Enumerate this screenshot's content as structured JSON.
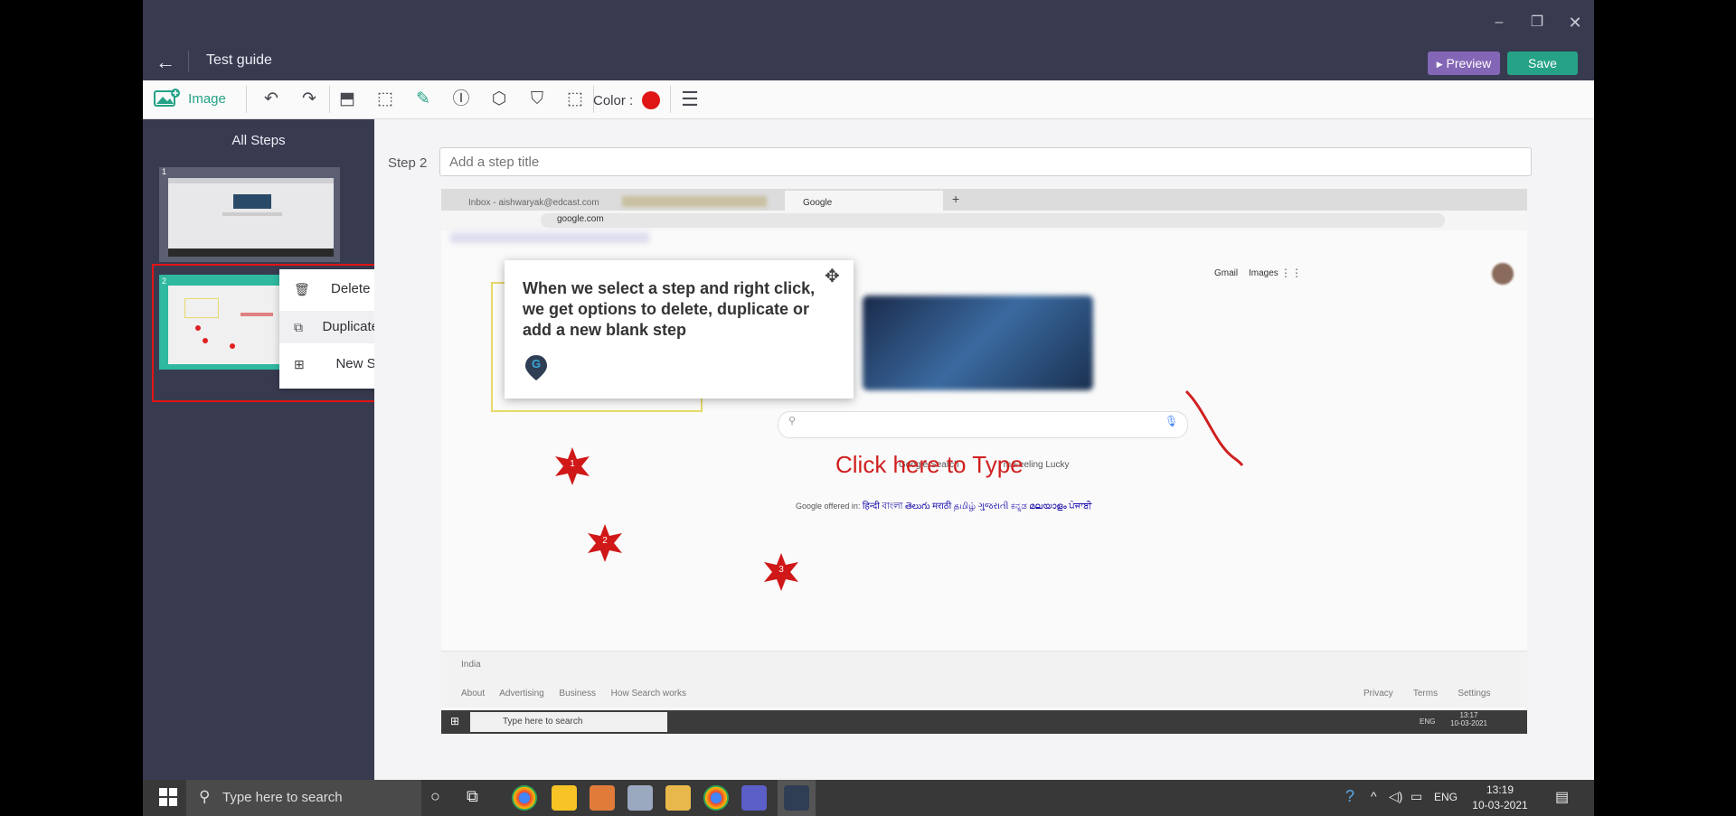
{
  "window": {
    "title": "Test guide",
    "controls": {
      "minimize": "–",
      "restore": "❐",
      "close": "✕"
    }
  },
  "header": {
    "back_icon": "←",
    "preview_label": "Preview",
    "save_label": "Save"
  },
  "toolbar": {
    "image_label": "Image",
    "color_label": "Color :",
    "current_color": "#e01515",
    "icons": {
      "undo": "↶",
      "redo": "↷",
      "shape": "⬒",
      "crop": "⬚",
      "pen": "✎",
      "text": "Ⓘ",
      "hexagon": "⬡",
      "stamp": "⛉",
      "select": "⬚",
      "menu": "☰"
    }
  },
  "sidebar": {
    "heading": "All Steps",
    "steps": [
      {
        "number": "1"
      },
      {
        "number": "2"
      }
    ],
    "context_menu": [
      {
        "label": "Delete step",
        "icon": "🗑"
      },
      {
        "label": "Duplicate step",
        "icon": "⧉"
      },
      {
        "label": "New Step",
        "icon": "⊞"
      }
    ]
  },
  "editor": {
    "step_label": "Step 2",
    "title_placeholder": "Add a step title"
  },
  "screenshot": {
    "tabs": [
      {
        "label": "Inbox - aishwaryak@edcast.com"
      },
      {
        "label": "Google"
      }
    ],
    "new_tab": "+",
    "url": "google.com",
    "header_links": {
      "gmail": "Gmail",
      "images": "Images"
    },
    "annotation_text": "Click here to Type",
    "stars": [
      "1",
      "2",
      "3"
    ],
    "search_buttons": {
      "search": "Google Search",
      "lucky": "I'm Feeling Lucky"
    },
    "offered_in": "Google offered in:",
    "languages": [
      "हिन्दी",
      "বাংলা",
      "తెలుగు",
      "मराठी",
      "தமிழ்",
      "ગુજરાતી",
      "ಕನ್ನಡ",
      "മലയാളം",
      "ਪੰਜਾਬੀ"
    ],
    "footer_country": "India",
    "footer_left": [
      "About",
      "Advertising",
      "Business",
      "How Search works"
    ],
    "footer_right": [
      "Privacy",
      "Terms",
      "Settings"
    ],
    "inner_taskbar": {
      "search_placeholder": "Type here to search",
      "lang": "ENG",
      "time": "13:17",
      "date": "10-03-2021"
    }
  },
  "tooltip": {
    "text": "When we select a step and right click, we get options to delete, duplicate or add a new blank step",
    "logo_letter": "G",
    "move_icon": "✥"
  },
  "taskbar": {
    "search_placeholder": "Type here to search",
    "lang": "ENG",
    "time": "13:19",
    "date": "10-03-2021"
  }
}
